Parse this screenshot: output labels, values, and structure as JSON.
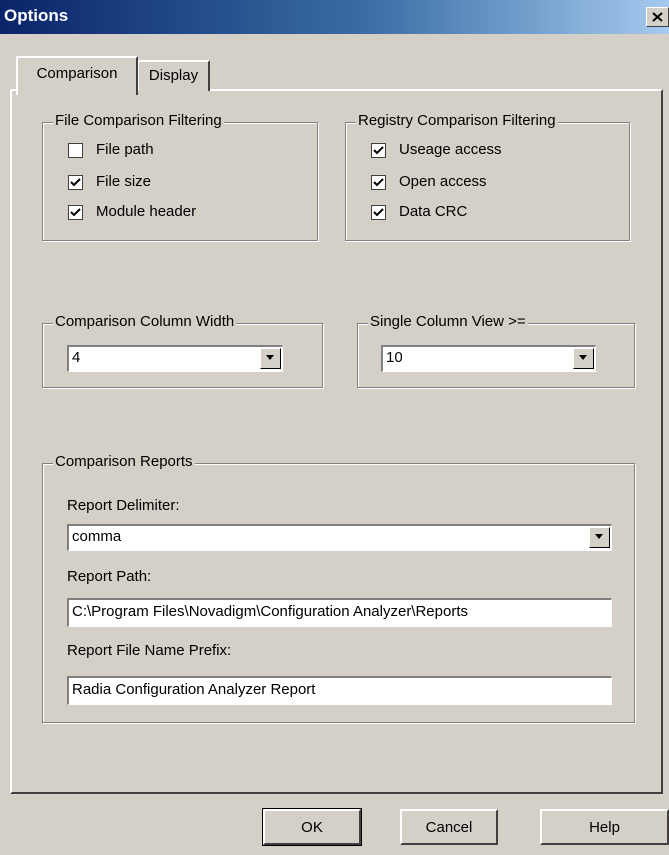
{
  "window": {
    "title": "Options"
  },
  "tabs": [
    {
      "label": "Comparison",
      "active": true
    },
    {
      "label": "Display",
      "active": false
    }
  ],
  "file_filter": {
    "legend": "File Comparison Filtering",
    "items": [
      {
        "label": "File path",
        "checked": false
      },
      {
        "label": "File size",
        "checked": true
      },
      {
        "label": "Module header",
        "checked": true
      }
    ]
  },
  "registry_filter": {
    "legend": "Registry Comparison Filtering",
    "items": [
      {
        "label": "Useage access",
        "checked": true
      },
      {
        "label": "Open access",
        "checked": true
      },
      {
        "label": "Data CRC",
        "checked": true
      }
    ]
  },
  "column_width": {
    "legend": "Comparison Column Width",
    "value": "4"
  },
  "single_column": {
    "legend": "Single Column View >=",
    "value": "10"
  },
  "reports": {
    "legend": "Comparison Reports",
    "delimiter_label": "Report Delimiter:",
    "delimiter_value": "comma",
    "path_label": "Report Path:",
    "path_value": "C:\\Program Files\\Novadigm\\Configuration Analyzer\\Reports",
    "prefix_label": "Report File Name Prefix:",
    "prefix_value": "Radia Configuration Analyzer Report"
  },
  "buttons": {
    "ok": "OK",
    "cancel": "Cancel",
    "help": "Help"
  },
  "colors": {
    "title_start": "#0a246a",
    "title_end": "#a6caf0",
    "face": "#d4d0c8"
  },
  "icons": {
    "close": "close-icon",
    "check": "check-icon",
    "dropdown": "chevron-down-icon"
  }
}
